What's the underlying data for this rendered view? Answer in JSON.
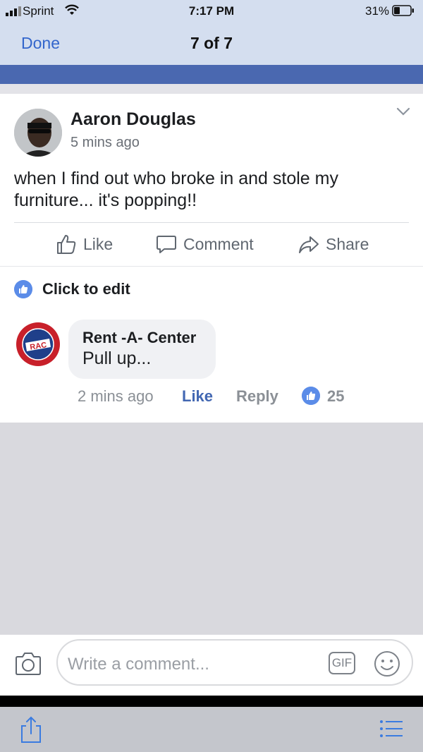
{
  "status": {
    "carrier": "Sprint",
    "time": "7:17 PM",
    "battery": "31%"
  },
  "nav": {
    "done": "Done",
    "counter": "7 of 7"
  },
  "post": {
    "author": "Aaron Douglas",
    "time": "5 mins ago",
    "text": "when I find out who broke in and stole my furniture... it's popping!!",
    "actions": {
      "like": "Like",
      "comment": "Comment",
      "share": "Share"
    }
  },
  "edit": {
    "label": "Click to edit"
  },
  "comment": {
    "author": "Rent -A- Center",
    "text": "Pull up...",
    "time": "2 mins ago",
    "like": "Like",
    "reply": "Reply",
    "reactions": "25"
  },
  "composer": {
    "placeholder": "Write a comment...",
    "gif": "GIF"
  },
  "colors": {
    "accent": "#4267b2",
    "nav_bg": "#d4deef",
    "fb_blue": "#4a68b0",
    "reaction_blue": "#5b8ce8"
  },
  "icons": [
    "signal-icon",
    "wifi-icon",
    "battery-icon",
    "chevron-down-icon",
    "like-icon",
    "comment-icon",
    "share-icon",
    "thumbs-up-badge-icon",
    "camera-icon",
    "gif-icon",
    "emoji-icon",
    "share-sheet-icon",
    "list-icon"
  ]
}
